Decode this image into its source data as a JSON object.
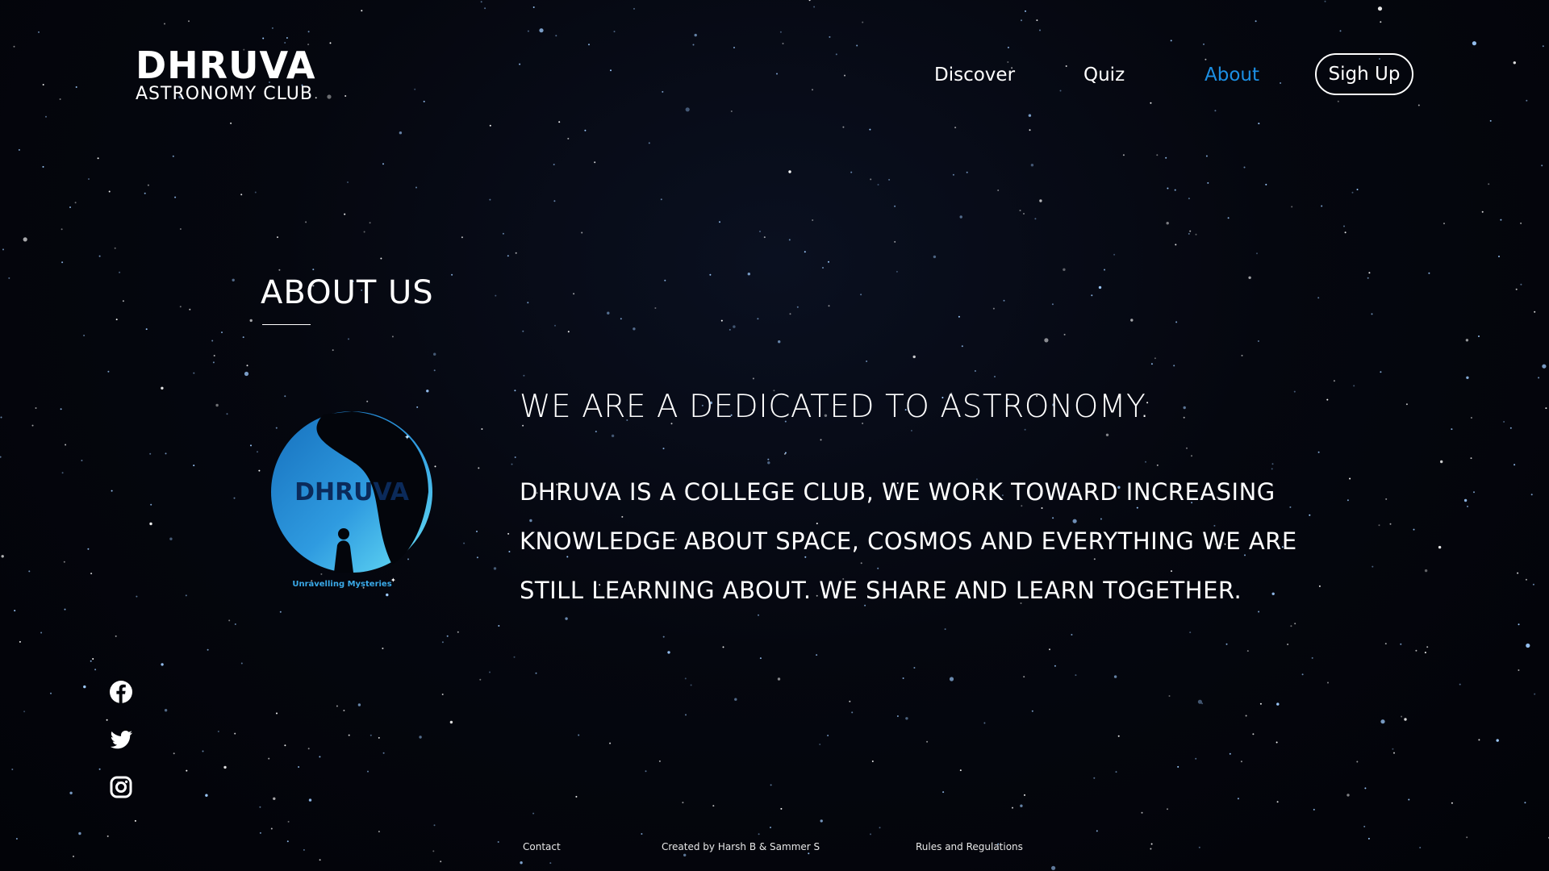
{
  "brand": {
    "title": "DHRUVA",
    "subtitle": "ASTRONOMY CLUB"
  },
  "nav": {
    "items": [
      {
        "label": "Discover",
        "active": false
      },
      {
        "label": "Quiz",
        "active": false
      },
      {
        "label": "About",
        "active": true
      }
    ],
    "signup_label": "Sigh Up",
    "active_color": "#1c8fe3"
  },
  "about": {
    "heading": "ABOUT US",
    "logo": {
      "text": "DHRUVA",
      "caption": "Unravelling Mysteries",
      "colors": [
        "#1a72c4",
        "#58d9f5"
      ]
    },
    "tagline": "WE ARE A DEDICATED TO ASTRONOMY.",
    "description": "DHRUVA IS A COLLEGE CLUB, WE WORK TOWARD INCREASING KNOWLEDGE ABOUT SPACE, COSMOS AND EVERYTHING WE ARE STILL LEARNING ABOUT. WE SHARE AND LEARN TOGETHER."
  },
  "social": {
    "icons": [
      "facebook-icon",
      "twitter-icon",
      "instagram-icon"
    ]
  },
  "footer": {
    "contact": "Contact",
    "credit": "Created by Harsh B & Sammer S",
    "rules": "Rules and Regulations"
  },
  "theme": {
    "background": "#03050b",
    "star_color": "#9ecbff"
  }
}
